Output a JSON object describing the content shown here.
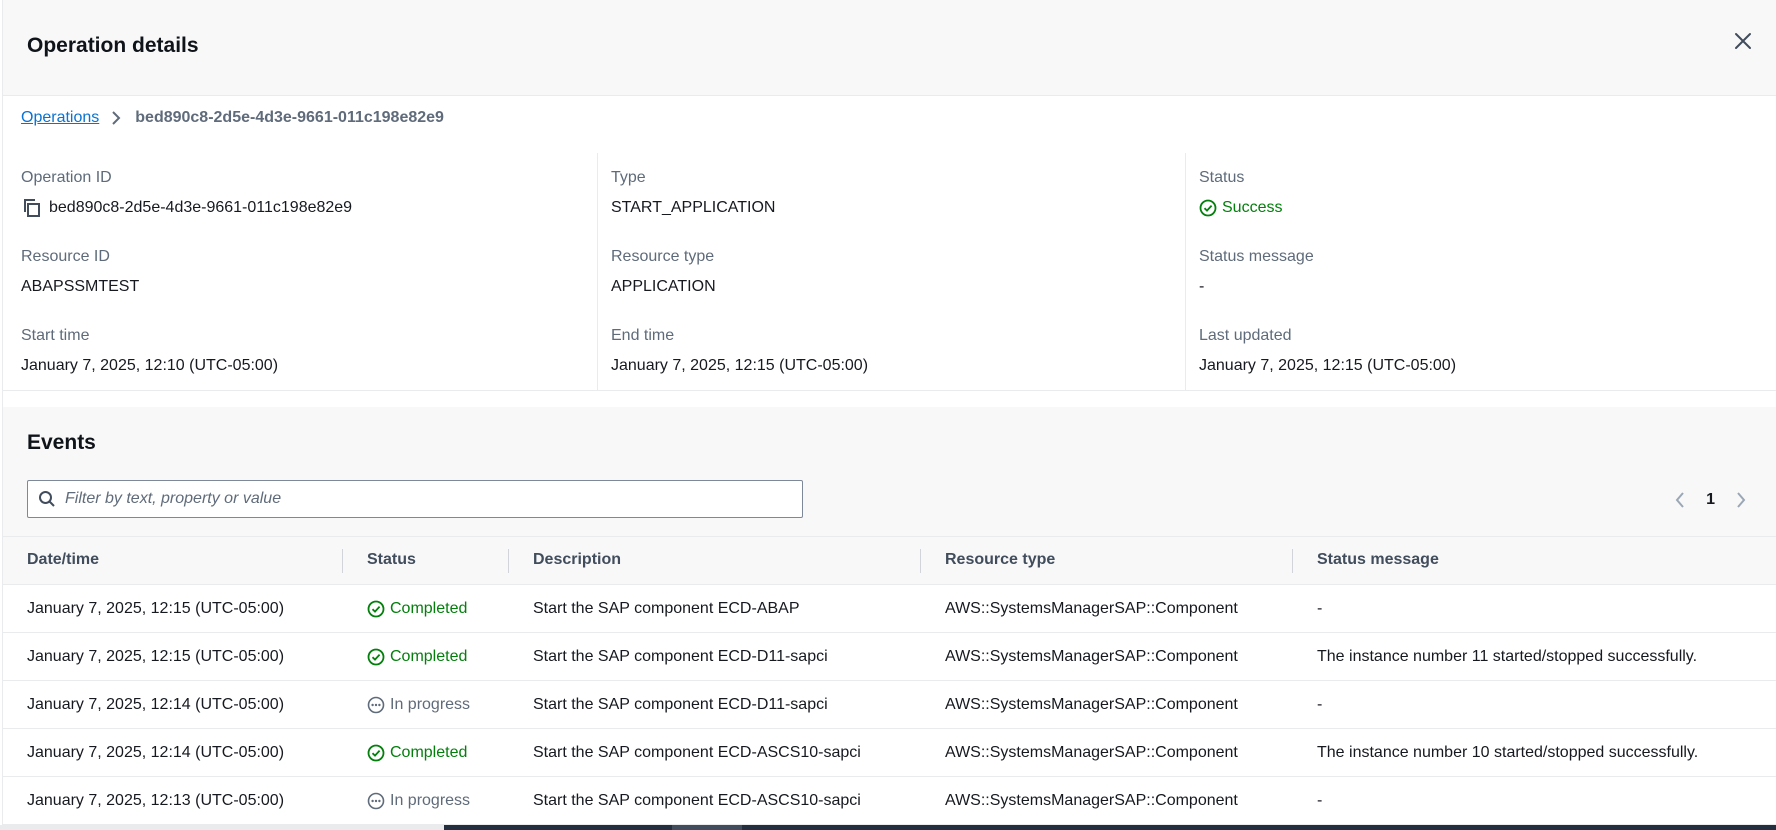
{
  "modal": {
    "title": "Operation details"
  },
  "breadcrumb": {
    "parent": "Operations",
    "current": "bed890c8-2d5e-4d3e-9661-011c198e82e9"
  },
  "details": {
    "operation_id": {
      "label": "Operation ID",
      "value": "bed890c8-2d5e-4d3e-9661-011c198e82e9"
    },
    "type": {
      "label": "Type",
      "value": "START_APPLICATION"
    },
    "status": {
      "label": "Status",
      "value": "Success"
    },
    "resource_id": {
      "label": "Resource ID",
      "value": "ABAPSSMTEST"
    },
    "resource_type": {
      "label": "Resource type",
      "value": "APPLICATION"
    },
    "status_message": {
      "label": "Status message",
      "value": "-"
    },
    "start_time": {
      "label": "Start time",
      "value": "January 7, 2025, 12:10 (UTC-05:00)"
    },
    "end_time": {
      "label": "End time",
      "value": "January 7, 2025, 12:15 (UTC-05:00)"
    },
    "last_updated": {
      "label": "Last updated",
      "value": "January 7, 2025, 12:15 (UTC-05:00)"
    }
  },
  "events": {
    "title": "Events",
    "filter_placeholder": "Filter by text, property or value",
    "current_page": "1",
    "columns": [
      "Date/time",
      "Status",
      "Description",
      "Resource type",
      "Status message"
    ],
    "rows": [
      {
        "datetime": "January 7, 2025, 12:15 (UTC-05:00)",
        "status": "Completed",
        "description": "Start the SAP component ECD-ABAP",
        "resource_type": "AWS::SystemsManagerSAP::Component",
        "status_message": "-"
      },
      {
        "datetime": "January 7, 2025, 12:15 (UTC-05:00)",
        "status": "Completed",
        "description": "Start the SAP component ECD-D11-sapci",
        "resource_type": "AWS::SystemsManagerSAP::Component",
        "status_message": "The instance number 11 started/stopped successfully."
      },
      {
        "datetime": "January 7, 2025, 12:14 (UTC-05:00)",
        "status": "In progress",
        "description": "Start the SAP component ECD-D11-sapci",
        "resource_type": "AWS::SystemsManagerSAP::Component",
        "status_message": "-"
      },
      {
        "datetime": "January 7, 2025, 12:14 (UTC-05:00)",
        "status": "Completed",
        "description": "Start the SAP component ECD-ASCS10-sapci",
        "resource_type": "AWS::SystemsManagerSAP::Component",
        "status_message": "The instance number 10 started/stopped successfully."
      },
      {
        "datetime": "January 7, 2025, 12:13 (UTC-05:00)",
        "status": "In progress",
        "description": "Start the SAP component ECD-ASCS10-sapci",
        "resource_type": "AWS::SystemsManagerSAP::Component",
        "status_message": "-"
      }
    ]
  },
  "colors": {
    "link": "#0972d3",
    "success": "#037f0c",
    "muted": "#5f6b7a",
    "panel_bg": "#f8f8f8"
  },
  "icons": {
    "close": "close-icon",
    "breadcrumb_separator": "chevron-right-icon",
    "copy": "copy-icon",
    "success": "check-circle-icon",
    "in_progress": "ellipsis-circle-icon",
    "search": "search-icon",
    "prev_page": "chevron-left-icon",
    "next_page": "chevron-right-icon"
  }
}
